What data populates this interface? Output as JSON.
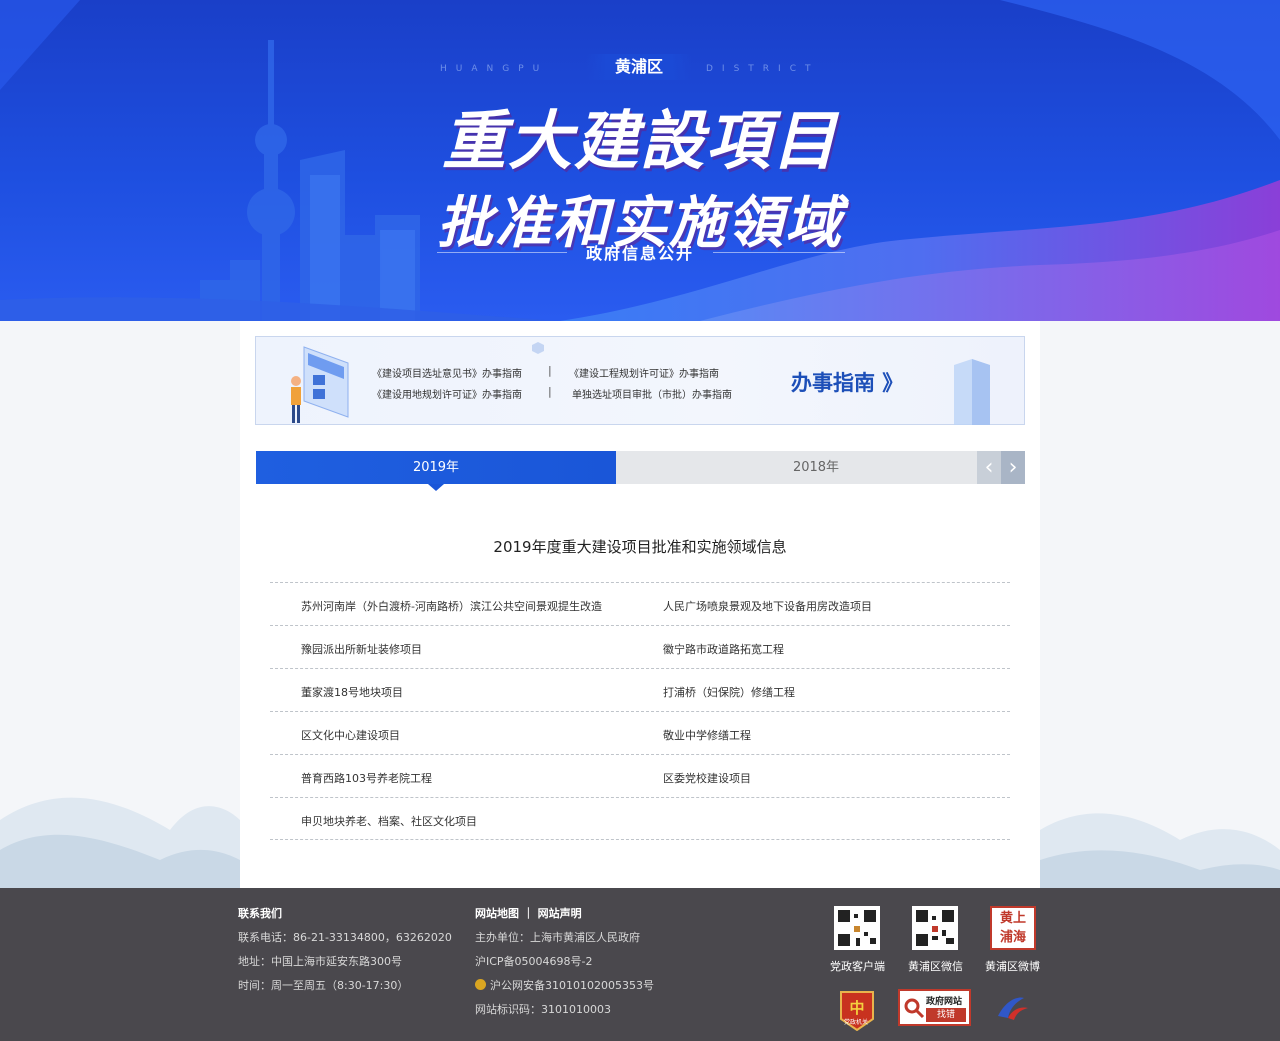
{
  "banner": {
    "district": "黄浦区",
    "en_left": "HUANGPU",
    "en_right": "DISTRICT",
    "title_line1": "重大建設項目",
    "title_line2": "批准和实施領域",
    "subtitle": "政府信息公开"
  },
  "guide": {
    "links": [
      "《建设项目选址意见书》办事指南",
      "《建设工程规划许可证》办事指南",
      "《建设用地规划许可证》办事指南",
      "单独选址项目审批（市批）办事指南"
    ],
    "separator": "|",
    "cta": "办事指南 》"
  },
  "tabs": {
    "active": "2019年",
    "inactive": "2018年",
    "prev": "‹",
    "next": "›"
  },
  "section_title": "2019年度重大建设项目批准和实施领域信息",
  "projects": [
    [
      "苏州河南岸（外白渡桥-河南路桥）滨江公共空间景观提生改造",
      "人民广场喷泉景观及地下设备用房改造项目"
    ],
    [
      "豫园派出所新址装修项目",
      "徽宁路市政道路拓宽工程"
    ],
    [
      "董家渡18号地块项目",
      "打浦桥（妇保院）修缮工程"
    ],
    [
      "区文化中心建设项目",
      "敬业中学修缮工程"
    ],
    [
      "普育西路103号养老院工程",
      "区委党校建设项目"
    ],
    [
      "申贝地块养老、档案、社区文化项目",
      ""
    ]
  ],
  "footer": {
    "contact_head": "联系我们",
    "phone": "联系电话：86-21-33134800，63262020",
    "address": "地址：中国上海市延安东路300号",
    "hours": "时间：周一至周五（8:30-17:30）",
    "links_head": "网站地图 ｜ 网站声明",
    "sponsor": "主办单位：上海市黄浦区人民政府",
    "icp": "沪ICP备05004698号-2",
    "police": "沪公网安备31010102005353号",
    "site_id": "网站标识码：3101010003",
    "qr_labels": [
      "党政客户端",
      "黄浦区微信",
      "黄浦区微博"
    ],
    "weibo_logo": "黄上浦海",
    "badge_party": "党政机关",
    "badge_find_top": "政府网站",
    "badge_find_bottom": "找错"
  },
  "colors": {
    "banner_blue": "#1e4fe0",
    "accent_purple": "#7b3fd6",
    "tab_active": "#1a56d8",
    "footer_bg": "#4a484d"
  }
}
